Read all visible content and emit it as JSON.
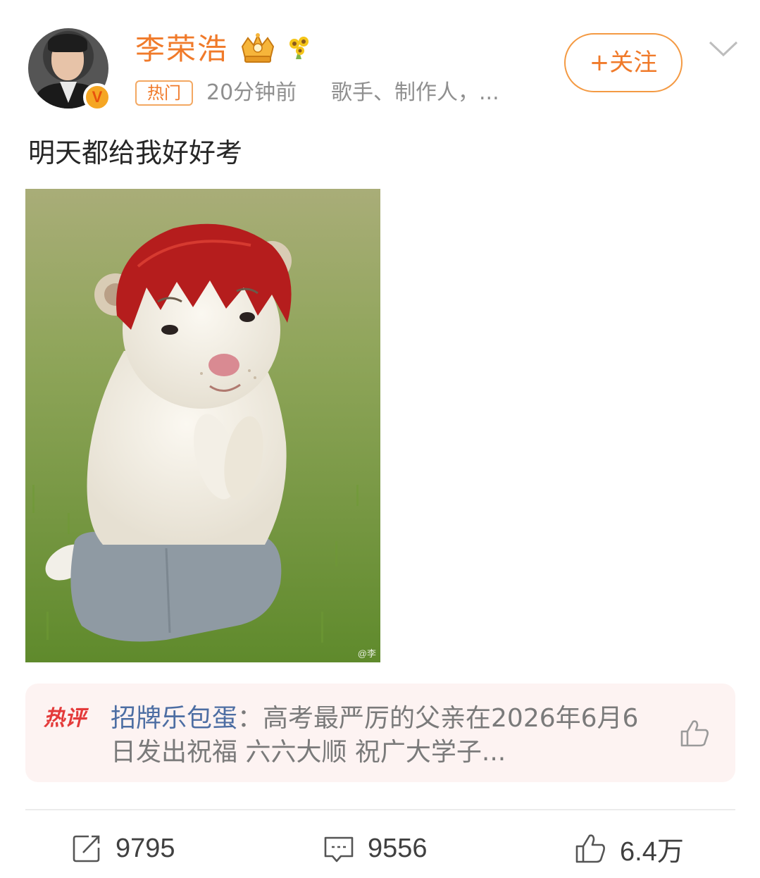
{
  "post": {
    "author": {
      "name": "李荣浩",
      "verified_badge": "V"
    },
    "hot_tag": "热门",
    "time": "20分钟前",
    "description": "歌手、制作人，...",
    "follow_label": "+关注",
    "text": "明天都给我好好考",
    "image": {
      "watermark": "@李"
    }
  },
  "hot_comment": {
    "label": "热评",
    "author": "招牌乐包蛋",
    "separator": "：",
    "text": "高考最严厉的父亲在2026年6月6日发出祝福 六六大顺 祝广大学子..."
  },
  "actions": {
    "repost_count": "9795",
    "comment_count": "9556",
    "like_count": "6.4万"
  },
  "colors": {
    "accent": "#f07a2a",
    "hot_red": "#e43a3a",
    "link_blue": "#4d6ea3"
  }
}
